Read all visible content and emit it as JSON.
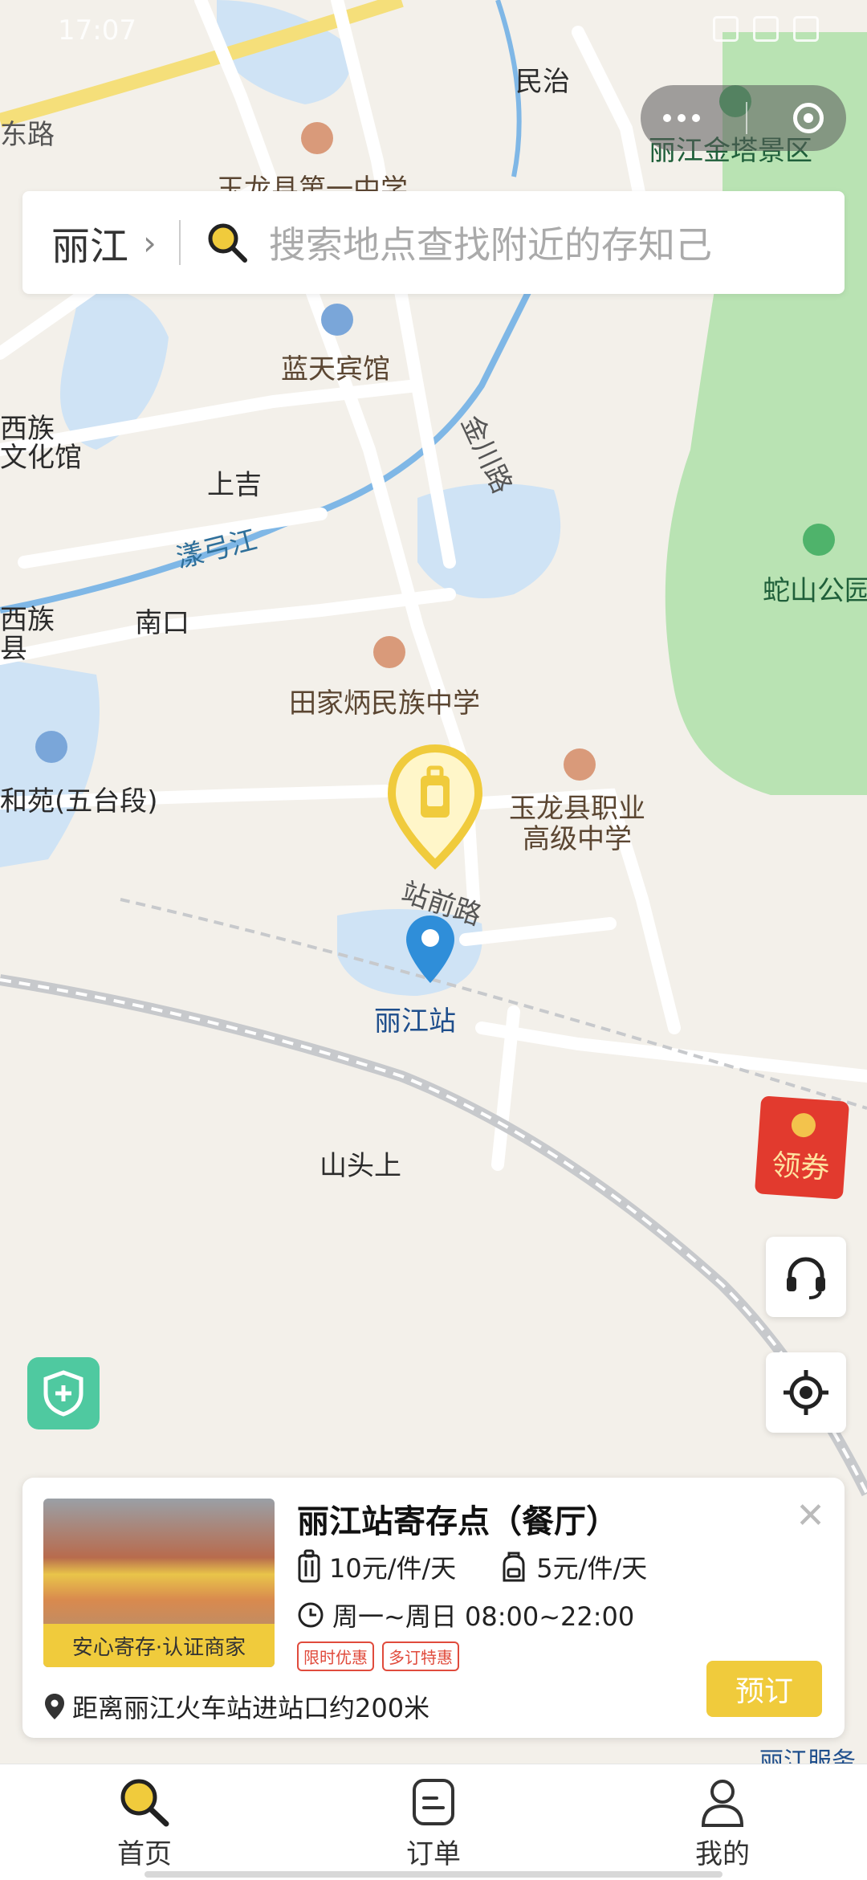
{
  "status_bar": {
    "time": "17:07"
  },
  "search": {
    "city": "丽江",
    "placeholder": "搜索地点查找附近的存知己"
  },
  "map": {
    "labels": {
      "minzhi": "民治",
      "jinta": "丽江金塔景区",
      "yulong_no1": "玉龙县第一中学",
      "dong_lu": "东路",
      "lantian": "蓝天宾馆",
      "naxi_culture": "西族\n文化馆",
      "shangji": "上吉",
      "jinchuan_lu": "金川路",
      "yanggong": "漾弓江",
      "nankou": "南口",
      "naxi_county": "西族\n县",
      "tianjiabing": "田家炳民族中学",
      "heyuan": "和苑(五台段)",
      "yulong_vocational": "玉龙县职业\n高级中学",
      "zhanqian": "站前路",
      "lijiang_station": "丽江站",
      "shantou": "山头上",
      "sheshan": "蛇山公园",
      "lijiang_service": "丽江服务"
    }
  },
  "right_buttons": {
    "coupon_label": "领券"
  },
  "card": {
    "title": "丽江站寄存点（餐厅）",
    "photo_badge": "安心寄存·认证商家",
    "price_luggage": "10元/件/天",
    "price_bag": "5元/件/天",
    "hours": "周一~周日 08:00~22:00",
    "tag_limited": "限时优惠",
    "tag_multi": "多订特惠",
    "distance": "距离丽江火车站进站口约200米",
    "book_label": "预订"
  },
  "tabs": [
    {
      "label": "首页"
    },
    {
      "label": "订单"
    },
    {
      "label": "我的"
    }
  ],
  "colors": {
    "accent": "#f0cb3c",
    "park": "#b9e3b3",
    "water": "#cfe3f5",
    "road": "#ffffff"
  }
}
